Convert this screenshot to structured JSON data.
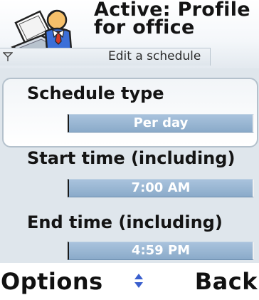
{
  "header": {
    "title_line1": "Active: Profile",
    "title_line2": "for office",
    "subtitle": "Edit a schedule",
    "icon": "profile-office-icon"
  },
  "form": {
    "fields": [
      {
        "label": "Schedule type",
        "value": "Per day"
      },
      {
        "label": "Start time (including)",
        "value": "7:00 AM"
      },
      {
        "label": "End time (including)",
        "value": "4:59 PM"
      }
    ]
  },
  "softkeys": {
    "left": "Options",
    "right": "Back",
    "nav_icon": "up-down-arrows-icon"
  },
  "colors": {
    "accent": "#8aaac9",
    "nav_arrows": "#3a5fcd"
  }
}
